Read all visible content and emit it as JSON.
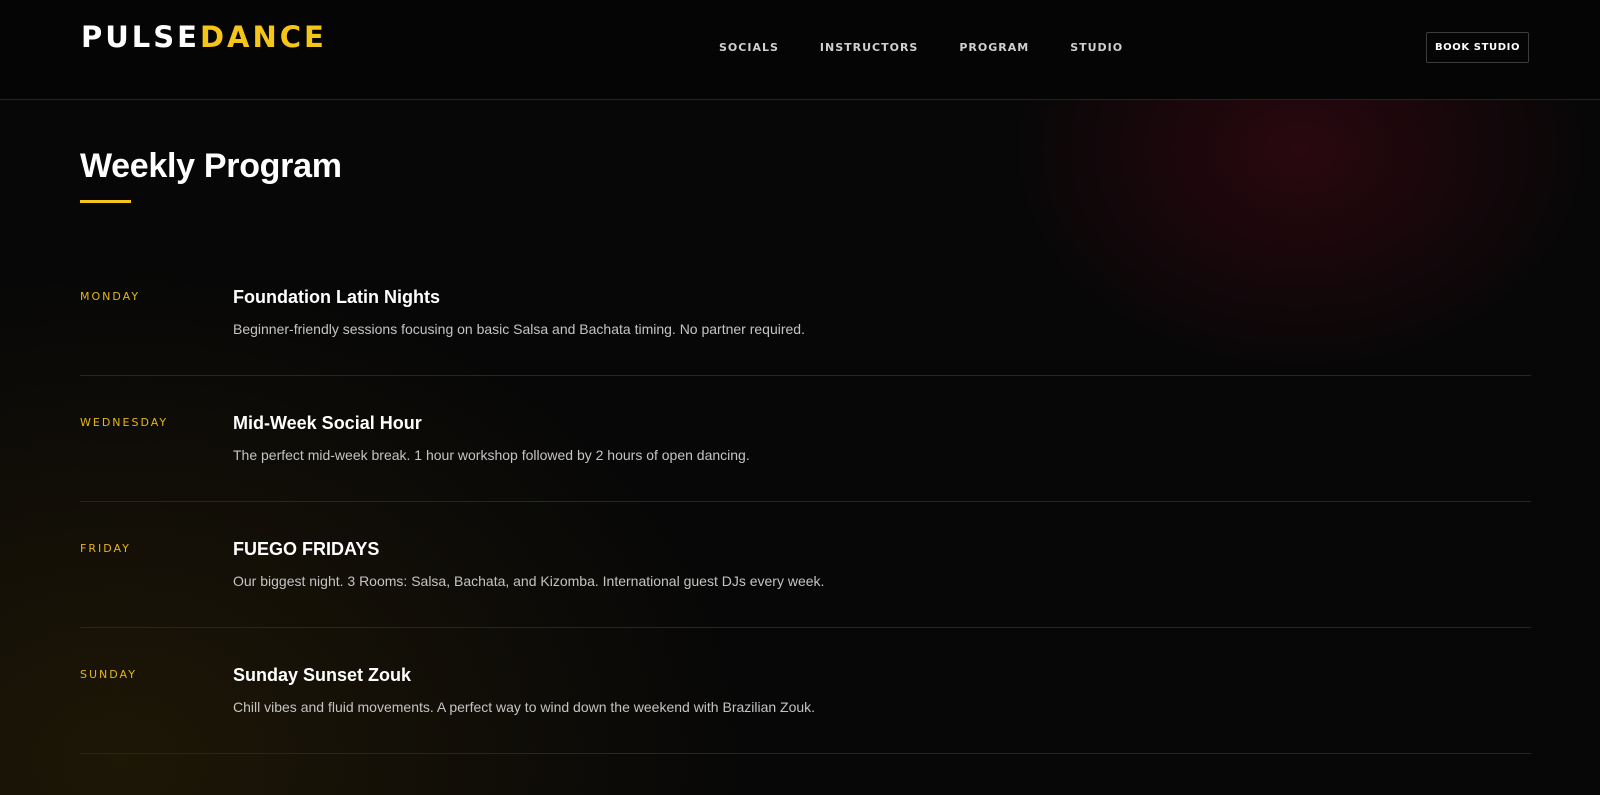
{
  "brand": {
    "logo_part1": "PULSE",
    "logo_part2": "DANCE",
    "accent_color": "#f5c518"
  },
  "nav": {
    "items": [
      "SOCIALS",
      "INSTRUCTORS",
      "PROGRAM",
      "STUDIO"
    ]
  },
  "header": {
    "cta_label": "BOOK STUDIO"
  },
  "main": {
    "title": "Weekly Program",
    "schedule": [
      {
        "day": "Monday",
        "event": "Foundation Latin Nights",
        "description": "Beginner-friendly sessions focusing on basic Salsa and Bachata timing. No partner required."
      },
      {
        "day": "Wednesday",
        "event": "Mid-Week Social Hour",
        "description": "The perfect mid-week break. 1 hour workshop followed by 2 hours of open dancing."
      },
      {
        "day": "Friday",
        "event": "FUEGO FRIDAYS",
        "description": "Our biggest night. 3 Rooms: Salsa, Bachata, and Kizomba. International guest DJs every week."
      },
      {
        "day": "Sunday",
        "event": "Sunday Sunset Zouk",
        "description": "Chill vibes and fluid movements. A perfect way to wind down the weekend with Brazilian Zouk."
      }
    ]
  }
}
